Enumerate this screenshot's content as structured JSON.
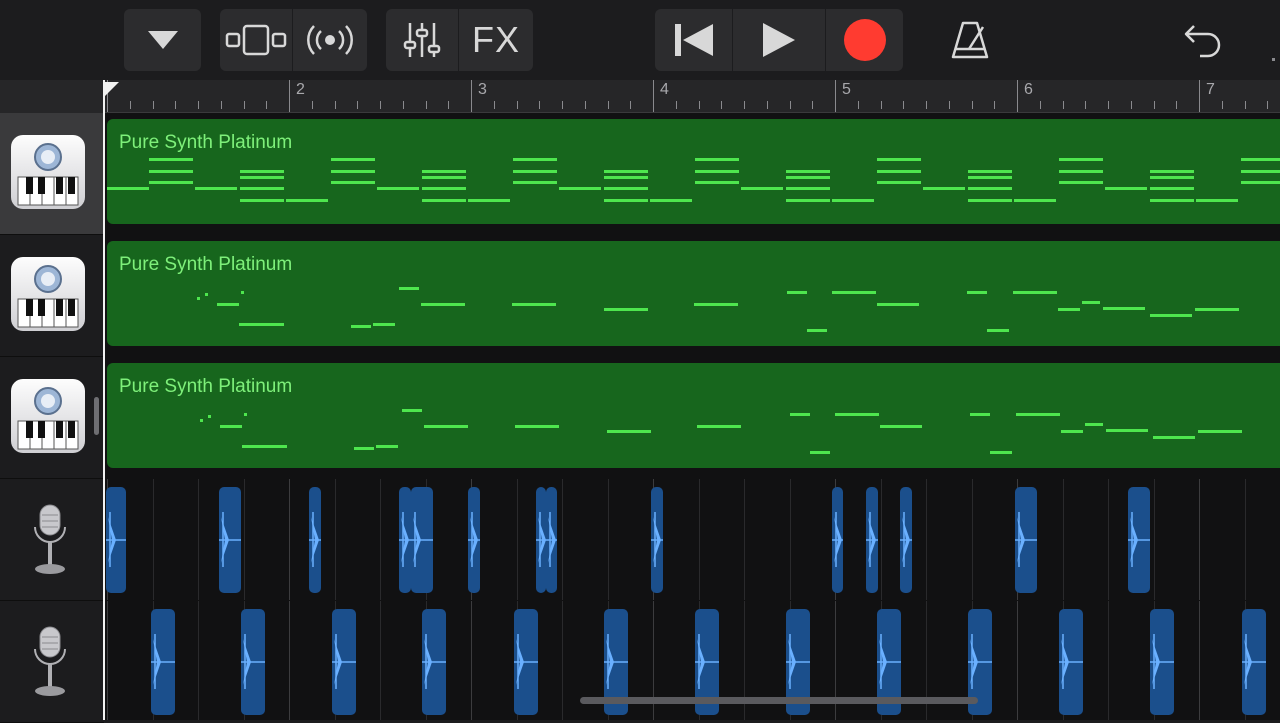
{
  "toolbar": {
    "buttons": [
      "browser",
      "view-toggle",
      "live-loops",
      "mixer",
      "fx",
      "go-to-beginning",
      "play",
      "record",
      "metronome",
      "undo"
    ],
    "fx_label": "FX",
    "record_color": "#ff3b30"
  },
  "ruler": {
    "bar_numbers": [
      "2",
      "3",
      "4",
      "5",
      "6",
      "7"
    ]
  },
  "tracks": [
    {
      "type": "instrument",
      "icon": "keyboard-icon",
      "region_name": "Pure Synth Platinum",
      "selected": true
    },
    {
      "type": "instrument",
      "icon": "keyboard-icon",
      "region_name": "Pure Synth Platinum",
      "selected": false
    },
    {
      "type": "instrument",
      "icon": "keyboard-icon",
      "region_name": "Pure Synth Platinum",
      "selected": false
    },
    {
      "type": "audio",
      "icon": "microphone-icon"
    },
    {
      "type": "audio",
      "icon": "microphone-icon"
    }
  ],
  "colors": {
    "midi_region": "#17661d",
    "midi_note": "#4ee64e",
    "audio_region": "#1b4f8c",
    "audio_wave": "#6ab0ff"
  }
}
